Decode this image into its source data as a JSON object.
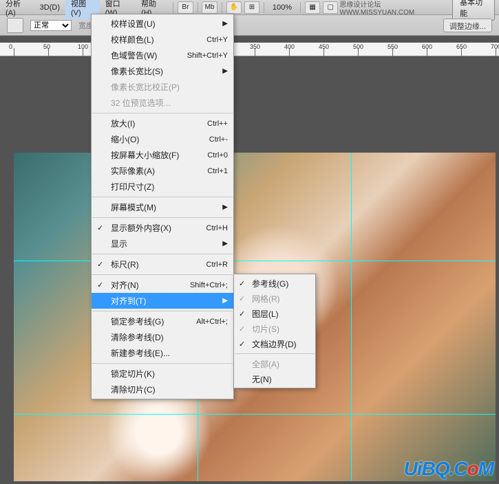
{
  "menubar": {
    "items": [
      "分析(A)",
      "3D(D)",
      "视图(V)",
      "窗口(W)",
      "帮助(H)"
    ],
    "toolbar_icons": [
      "Br",
      "Mb"
    ],
    "zoom": "100%",
    "right_text": "思缘设计论坛  WWW.MISSYUAN.COM",
    "basic_label": "基本功能"
  },
  "optionsbar": {
    "mode_label": "正常",
    "width_label": "宽度",
    "refine_btn": "调整边缘..."
  },
  "ruler_ticks": [
    0,
    50,
    100,
    350,
    400,
    450,
    500,
    550,
    600,
    650,
    700
  ],
  "guides": {
    "v": [
      267,
      490
    ],
    "h": [
      157,
      380
    ]
  },
  "view_menu": {
    "proof_setup": "校样设置(U)",
    "proof_colors": {
      "label": "校样颜色(L)",
      "sc": "Ctrl+Y"
    },
    "gamut": {
      "label": "色域警告(W)",
      "sc": "Shift+Ctrl+Y"
    },
    "pixel_aspect": "像素长宽比(S)",
    "pixel_aspect_correct": "像素长宽比校正(P)",
    "bit32_preview": "32 位预览选项...",
    "zoom_in": {
      "label": "放大(I)",
      "sc": "Ctrl++"
    },
    "zoom_out": {
      "label": "缩小(O)",
      "sc": "Ctrl+-"
    },
    "fit_screen": {
      "label": "按屏幕大小缩放(F)",
      "sc": "Ctrl+0"
    },
    "actual_pixels": {
      "label": "实际像素(A)",
      "sc": "Ctrl+1"
    },
    "print_size": "打印尺寸(Z)",
    "screen_mode": "屏幕模式(M)",
    "extras": {
      "label": "显示额外内容(X)",
      "sc": "Ctrl+H"
    },
    "show": "显示",
    "rulers": {
      "label": "标尺(R)",
      "sc": "Ctrl+R"
    },
    "snap": {
      "label": "对齐(N)",
      "sc": "Shift+Ctrl+;"
    },
    "snap_to": "对齐到(T)",
    "lock_guides": {
      "label": "锁定参考线(G)",
      "sc": "Alt+Ctrl+;"
    },
    "clear_guides": "清除参考线(D)",
    "new_guide": "新建参考线(E)...",
    "lock_slices": "锁定切片(K)",
    "clear_slices": "清除切片(C)"
  },
  "snap_submenu": {
    "guides": "参考线(G)",
    "grid": "网格(R)",
    "layers": "图层(L)",
    "slices": "切片(S)",
    "doc_bounds": "文档边界(D)",
    "all": "全部(A)",
    "none": "无(N)"
  },
  "watermark": {
    "part1": "UiBQ.C",
    "part2": "o",
    "part3": "M"
  }
}
